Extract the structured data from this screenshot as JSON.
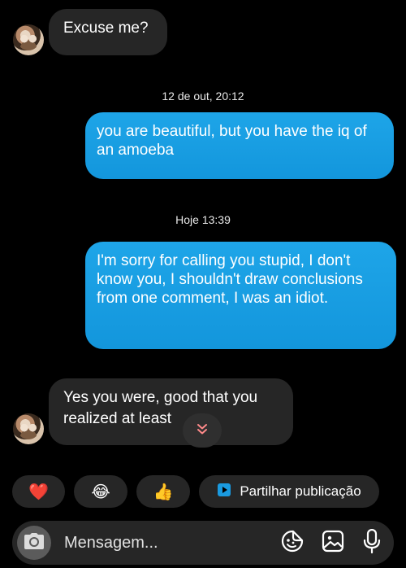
{
  "messages": [
    {
      "id": "m1",
      "direction": "in",
      "text": "Excuse me?"
    },
    {
      "id": "m2",
      "direction": "out",
      "text": "you are beautiful, but you have the iq of an amoeba"
    },
    {
      "id": "m3",
      "direction": "out",
      "text": "I'm sorry for calling you stupid, I don't know you, I shouldn't draw conclusions from one comment, I was an idiot."
    },
    {
      "id": "m4",
      "direction": "in",
      "text": "Yes you were, good that you realized at least"
    }
  ],
  "timestamps": [
    "12 de out, 20:12",
    "Hoje 13:39"
  ],
  "quick_replies": {
    "heart": "❤️",
    "laugh": "😂",
    "thumbs_up": "👍",
    "share_label": "Partilhar publicação"
  },
  "composer": {
    "placeholder": "Mensagem..."
  },
  "icons": {
    "camera": "camera-icon",
    "sticker": "sticker-icon",
    "gallery": "gallery-icon",
    "mic": "microphone-icon",
    "scroll": "chevron-double-down-icon",
    "share": "play-square-icon"
  },
  "colors": {
    "outgoing_bubble": "#1a9ae0",
    "incoming_bubble": "#262626",
    "background": "#000000",
    "scroll_chevron": "#ff8a8a"
  }
}
